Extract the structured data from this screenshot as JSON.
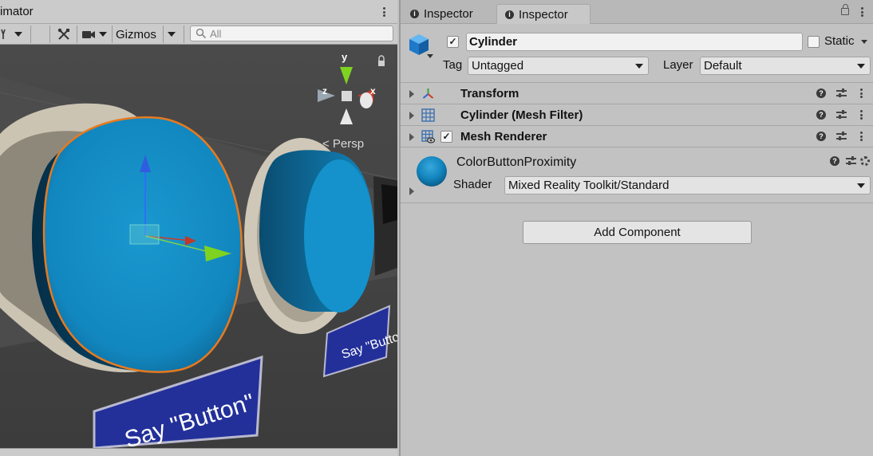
{
  "scene": {
    "tab_label": "imator",
    "toolbar": {
      "gizmos_label": "Gizmos",
      "search_placeholder": "All"
    },
    "persp_label": "< Persp",
    "gizmo_axis_labels": {
      "y": "y",
      "z": "z",
      "x": "x"
    },
    "labels": {
      "front_button": "Say \"Button\"",
      "back_button": "Say \"Button\""
    }
  },
  "inspector": {
    "tabs": [
      {
        "label": "Inspector",
        "active": false
      },
      {
        "label": "Inspector",
        "active": true
      }
    ],
    "game_object": {
      "active": true,
      "name": "Cylinder",
      "static_label": "Static",
      "static_checked": false,
      "tag_label": "Tag",
      "tag_value": "Untagged",
      "layer_label": "Layer",
      "layer_value": "Default"
    },
    "components": [
      {
        "name": "Transform",
        "icon": "transform-icon",
        "has_checkbox": false
      },
      {
        "name": "Cylinder (Mesh Filter)",
        "icon": "mesh-filter-icon",
        "has_checkbox": false
      },
      {
        "name": "Mesh Renderer",
        "icon": "mesh-renderer-icon",
        "has_checkbox": true,
        "enabled": true
      }
    ],
    "material": {
      "name": "ColorButtonProximity",
      "shader_label": "Shader",
      "shader_value": "Mixed Reality Toolkit/Standard",
      "preview_color": "#1386bf"
    },
    "add_component_label": "Add Component"
  },
  "colors": {
    "accent_blue": "#1386bf",
    "selection_outline": "#e87a1e",
    "label_blue": "#23309a"
  }
}
